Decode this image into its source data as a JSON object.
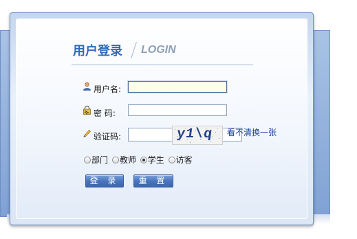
{
  "header": {
    "title_cn": "用户登录",
    "title_en": "LOGIN"
  },
  "form": {
    "username": {
      "label": "用户名:",
      "value": ""
    },
    "password": {
      "label": "密  码:",
      "value": ""
    },
    "captcha": {
      "label": "验证码:",
      "value": "",
      "image_text": "y1\\q",
      "refresh_label": "看不清换一张"
    },
    "roles": [
      {
        "label": "部门",
        "checked": false
      },
      {
        "label": "教师",
        "checked": false
      },
      {
        "label": "学生",
        "checked": true
      },
      {
        "label": "访客",
        "checked": false
      }
    ],
    "login_button": "登 录",
    "reset_button": "重 置"
  },
  "colors": {
    "title": "#2f6bb8",
    "button": "#4a76bd",
    "link": "#1a3ea0"
  }
}
